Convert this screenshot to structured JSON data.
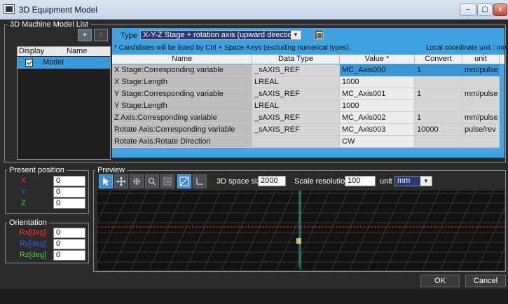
{
  "window": {
    "title": "3D Equipment Model",
    "minimize": "–",
    "maximize": "▢",
    "close": "x"
  },
  "model_list": {
    "group_label": "3D Machine Model List",
    "add_button": "+",
    "remove_button": "×",
    "columns": [
      "Display",
      "Name"
    ],
    "items": [
      {
        "name": "Model",
        "checked": true
      }
    ]
  },
  "type_panel": {
    "type_label": "Type",
    "type_value": "X-Y-Z Stage + rotation axis (upward direction)",
    "note": "* Candidates will be listed by Ctrl + Space Keys (excluding numerical types).",
    "coordinate_unit": "Local coordinate unit : mm"
  },
  "grid": {
    "columns": [
      "Name",
      "Data Type",
      "Value *",
      "Convert Value",
      "unit"
    ],
    "rows": [
      {
        "name": "X Stage:Corresponding variable",
        "data_type": "_sAXIS_REF",
        "value": "MC_Axis000",
        "convert": "1",
        "unit": "mm/pulse",
        "selected": true
      },
      {
        "name": "X Stage:Length",
        "data_type": "LREAL",
        "value": "1000",
        "convert": "",
        "unit": ""
      },
      {
        "name": "Y Stage:Corresponding variable",
        "data_type": "_sAXIS_REF",
        "value": "MC_Axis001",
        "convert": "1",
        "unit": "mm/pulse"
      },
      {
        "name": "Y Stage:Length",
        "data_type": "LREAL",
        "value": "1000",
        "convert": "",
        "unit": ""
      },
      {
        "name": "Z Axis:Corresponding variable",
        "data_type": "_sAXIS_REF",
        "value": "MC_Axis002",
        "convert": "1",
        "unit": "mm/pulse"
      },
      {
        "name": "Rotate Axis:Corresponding variable",
        "data_type": "_sAXIS_REF",
        "value": "MC_Axis003",
        "convert": "10000",
        "unit": "pulse/rev"
      },
      {
        "name": "Rotate Axis:Rotate Direction",
        "data_type": "",
        "value": "CW",
        "convert": "",
        "unit": ""
      }
    ]
  },
  "position": {
    "group_label": "Present position",
    "x_label": "X",
    "y_label": "Y",
    "z_label": "Z",
    "x_value": "0",
    "y_value": "0",
    "z_value": "0"
  },
  "orientation": {
    "group_label": "Orientation",
    "rx_label": "Rx[deg]",
    "ry_label": "Ry[deg]",
    "rz_label": "Rz[deg]",
    "rx_value": "0",
    "ry_value": "0",
    "rz_value": "0"
  },
  "preview": {
    "group_label": "Preview",
    "space_size_label": "3D space size",
    "space_size_value": "2000",
    "scale_label": "Scale resolution",
    "scale_value": "100",
    "unit_label": "unit",
    "unit_value": "mm"
  },
  "actions": {
    "ok": "OK",
    "cancel": "Cancel"
  },
  "colors": {
    "accent": "#3fa1e0",
    "selection": "#3b96d8",
    "x_axis": "#ff3333",
    "y_axis": "#2f64e0",
    "z_axis": "#4fd04f"
  }
}
